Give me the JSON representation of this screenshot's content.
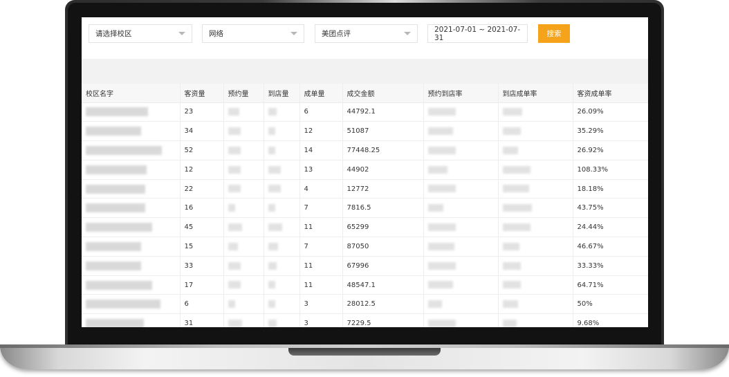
{
  "filters": {
    "campus_select": "请选择校区",
    "channel_select": "网络",
    "source_select": "美团点评",
    "date_range": "2021-07-01 ~ 2021-07-31",
    "search_label": "搜索"
  },
  "table": {
    "headers": [
      "校区名字",
      "客资量",
      "预约量",
      "到店量",
      "成单量",
      "成交金额",
      "预约到店率",
      "到店成单率",
      "客资成单率"
    ],
    "rows": [
      {
        "leads": "23",
        "orders": "6",
        "amount": "44792.1",
        "lead_rate": "26.09%"
      },
      {
        "leads": "34",
        "orders": "12",
        "amount": "51087",
        "lead_rate": "35.29%"
      },
      {
        "leads": "52",
        "orders": "14",
        "amount": "77448.25",
        "lead_rate": "26.92%"
      },
      {
        "leads": "12",
        "orders": "13",
        "amount": "44902",
        "lead_rate": "108.33%"
      },
      {
        "leads": "22",
        "orders": "4",
        "amount": "12772",
        "lead_rate": "18.18%"
      },
      {
        "leads": "16",
        "orders": "7",
        "amount": "7816.5",
        "lead_rate": "43.75%"
      },
      {
        "leads": "45",
        "orders": "11",
        "amount": "65299",
        "lead_rate": "24.44%"
      },
      {
        "leads": "15",
        "orders": "7",
        "amount": "87050",
        "lead_rate": "46.67%"
      },
      {
        "leads": "33",
        "orders": "11",
        "amount": "67996",
        "lead_rate": "33.33%"
      },
      {
        "leads": "17",
        "orders": "11",
        "amount": "48547.1",
        "lead_rate": "64.71%"
      },
      {
        "leads": "6",
        "orders": "3",
        "amount": "28012.5",
        "lead_rate": "50%"
      },
      {
        "leads": "31",
        "orders": "3",
        "amount": "7229.5",
        "lead_rate": "9.68%"
      }
    ]
  },
  "colors": {
    "accent": "#f5a31a",
    "band": "#f2f2f2",
    "header_bg": "#f7f7f7"
  }
}
